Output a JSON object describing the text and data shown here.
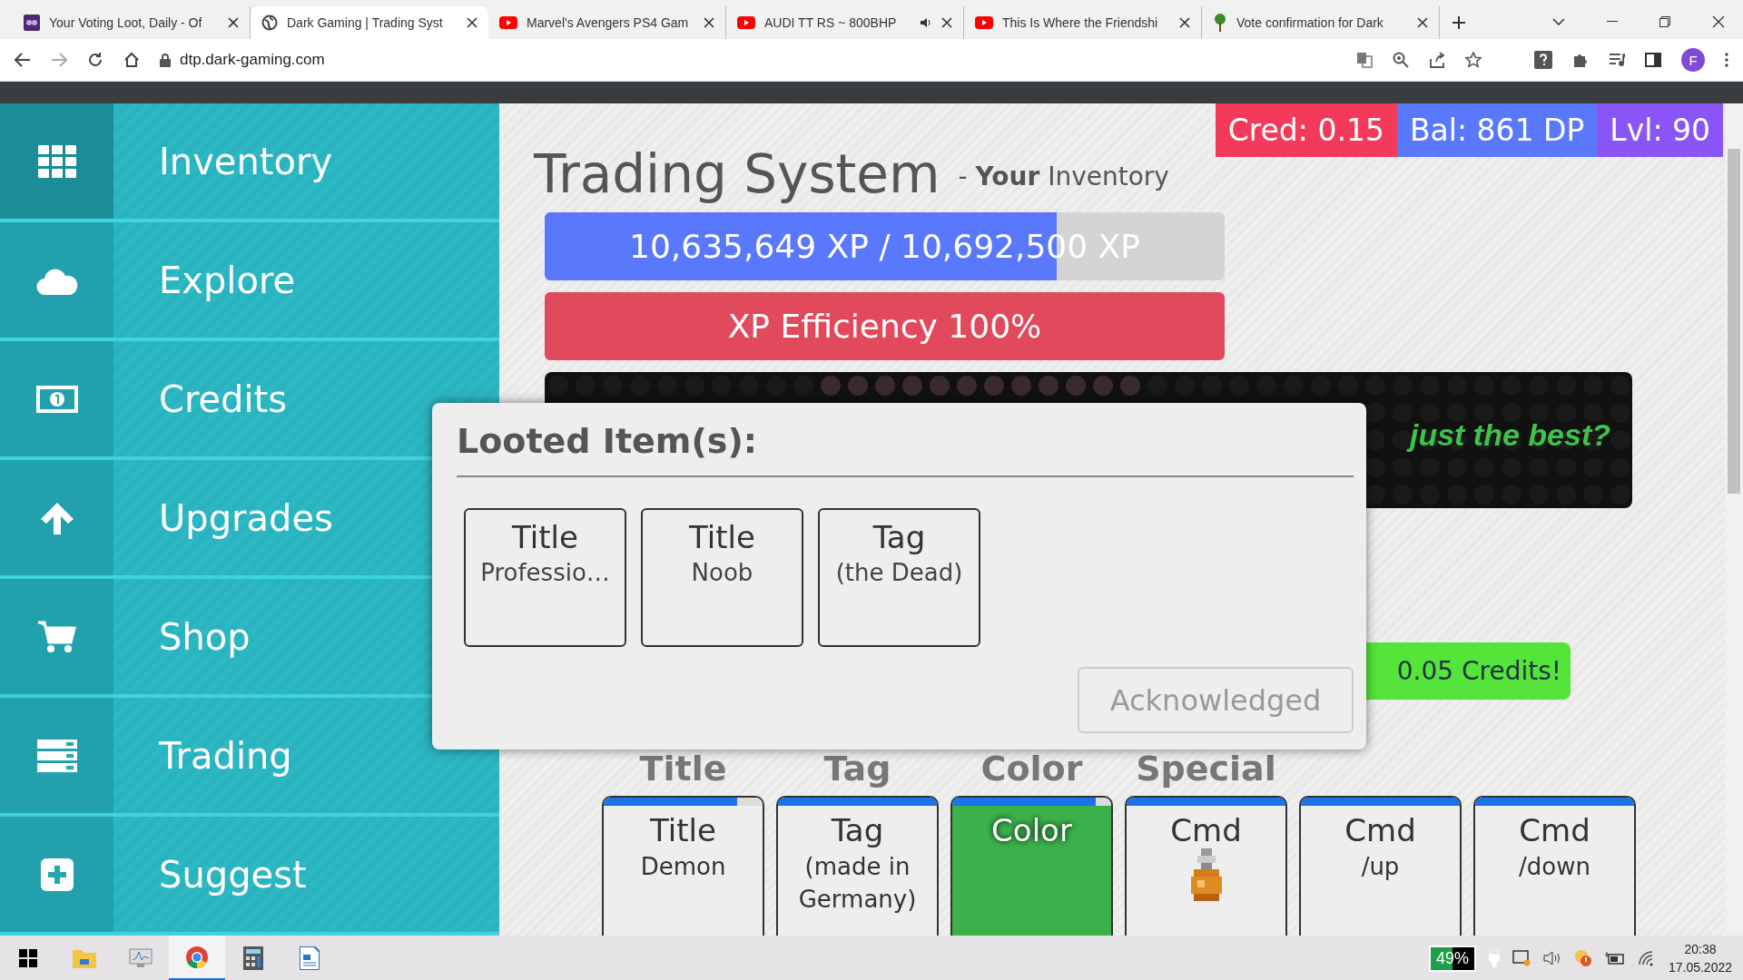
{
  "browser": {
    "tabs": [
      {
        "title": "Your Voting Loot, Daily - Of",
        "selected": false,
        "audio": false
      },
      {
        "title": "Dark Gaming | Trading Syst",
        "selected": true,
        "audio": false
      },
      {
        "title": "Marvel's Avengers PS4 Gam",
        "selected": false,
        "audio": false
      },
      {
        "title": "AUDI TT RS ~ 800BHP",
        "selected": false,
        "audio": true
      },
      {
        "title": "This Is Where the Friendshi",
        "selected": false,
        "audio": false
      },
      {
        "title": "Vote confirmation for Dark",
        "selected": false,
        "audio": false
      }
    ],
    "address": "dtp.dark-gaming.com",
    "profile": "F"
  },
  "sidebar": {
    "items": [
      {
        "label": "Inventory",
        "selected": true
      },
      {
        "label": "Explore",
        "selected": false
      },
      {
        "label": "Credits",
        "selected": false
      },
      {
        "label": "Upgrades",
        "selected": false
      },
      {
        "label": "Shop",
        "selected": false
      },
      {
        "label": "Trading",
        "selected": false
      },
      {
        "label": "Suggest",
        "selected": false
      }
    ]
  },
  "header": {
    "title": "Trading System",
    "subtitle": "- **Your** Inventory"
  },
  "stats": [
    {
      "text": "Cred: 0.15",
      "color": "#f43a5a"
    },
    {
      "text": "Bal: 861 DP",
      "color": "#5a78fb"
    },
    {
      "text": "Lvl: 90",
      "color": "#8a55f7"
    }
  ],
  "xp_bar": {
    "text": "10,635,649 XP / 10,692,500 XP",
    "level": 0.753
  },
  "efficiency_bar": {
    "text": "XP Efficiency 100%"
  },
  "banner": {
    "text": "just the best?"
  },
  "notice": {
    "text": "0.05 Credits!"
  },
  "column_headings": [
    "Title",
    "Tag",
    "Color",
    "Special"
  ],
  "cards": [
    {
      "kind": "text",
      "heading": "Title",
      "detail": "Demon",
      "level": 0.84
    },
    {
      "kind": "text",
      "heading": "Tag",
      "detail": "(made in Germany)",
      "level": 1
    },
    {
      "kind": "color",
      "heading": "Color",
      "color": "#3bb04b",
      "level": 0.9
    },
    {
      "kind": "icon",
      "heading": "Cmd",
      "level": 1
    },
    {
      "kind": "text",
      "heading": "Cmd",
      "detail": "/up",
      "level": 1
    },
    {
      "kind": "text",
      "heading": "Cmd",
      "detail": "/down",
      "level": 1
    }
  ],
  "dialog": {
    "title": "Looted Item(s):",
    "items": [
      {
        "heading": "Title",
        "detail": "Professio…"
      },
      {
        "heading": "Title",
        "detail": "Noob"
      },
      {
        "heading": "Tag",
        "detail": "(the Dead)"
      }
    ],
    "button": "Acknowledged"
  },
  "taskbar": {
    "battery": "49%",
    "time": "20:38",
    "date": "17.05.2022"
  }
}
